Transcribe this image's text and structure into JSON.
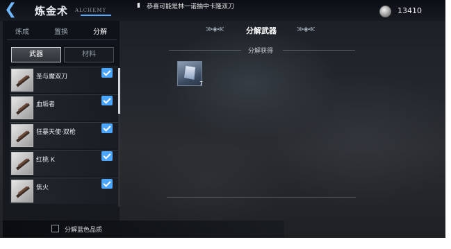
{
  "header": {
    "back_icon": "back-arrow-icon",
    "title": "炼金术",
    "title_en": "ALCHEMY",
    "notice_icon": "speaker-icon",
    "notice": "恭喜可能是林一诺抽中卡隆双刀",
    "currency_icon": "coin-icon",
    "currency_value": "13410"
  },
  "tabs": [
    {
      "label": "炼成",
      "active": false
    },
    {
      "label": "置换",
      "active": false
    },
    {
      "label": "分解",
      "active": true
    }
  ],
  "subtabs": [
    {
      "label": "武器",
      "active": true
    },
    {
      "label": "材料",
      "active": false
    }
  ],
  "items": [
    {
      "name": "圣与魔双刀",
      "checked": true
    },
    {
      "name": "血垢者",
      "checked": true
    },
    {
      "name": "狂暴天使·双枪",
      "checked": true
    },
    {
      "name": "红桃 K",
      "checked": true
    },
    {
      "name": "焦火",
      "checked": true
    }
  ],
  "bottom": {
    "option_label": "分解蓝色品质",
    "option_checked": false
  },
  "main": {
    "section_title": "分解武器",
    "sub_header": "分解获得",
    "result": {
      "icon": "blue-gem-icon",
      "count": "7"
    }
  },
  "colors": {
    "accent": "#4aa6ff",
    "back_arrow": "#6fb8ff"
  }
}
